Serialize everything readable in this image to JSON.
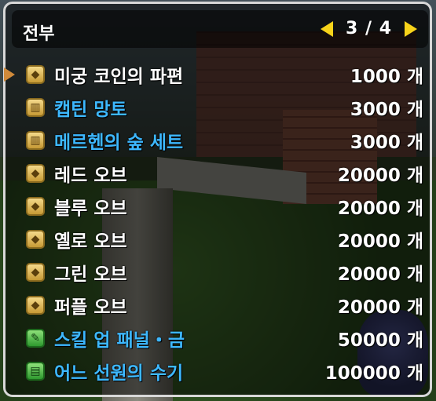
{
  "header": {
    "title": "전부",
    "page_indicator": "3 / 4"
  },
  "colors": {
    "accent_yellow": "#f7d31a",
    "name_blue": "#3db8ff",
    "name_white": "#ffffff",
    "selection_arrow": "#d08a3a"
  },
  "items": [
    {
      "name": "미궁 코인의 파편",
      "count": "1000 개",
      "icon": "coin-shard-icon",
      "name_color": "white",
      "selected": true
    },
    {
      "name": "캡틴 망토",
      "count": "3000 개",
      "icon": "gift-box-icon",
      "name_color": "blue",
      "selected": false
    },
    {
      "name": "메르헨의 숲 세트",
      "count": "3000 개",
      "icon": "gift-box-icon",
      "name_color": "blue",
      "selected": false
    },
    {
      "name": "레드 오브",
      "count": "20000 개",
      "icon": "coin-shard-icon",
      "name_color": "white",
      "selected": false
    },
    {
      "name": "블루 오브",
      "count": "20000 개",
      "icon": "coin-shard-icon",
      "name_color": "white",
      "selected": false
    },
    {
      "name": "옐로 오브",
      "count": "20000 개",
      "icon": "coin-shard-icon",
      "name_color": "white",
      "selected": false
    },
    {
      "name": "그린 오브",
      "count": "20000 개",
      "icon": "coin-shard-icon",
      "name_color": "white",
      "selected": false
    },
    {
      "name": "퍼플 오브",
      "count": "20000 개",
      "icon": "coin-shard-icon",
      "name_color": "white",
      "selected": false
    },
    {
      "name": "스킬 업 패널・금",
      "count": "50000 개",
      "icon": "leaf-panel-icon",
      "name_color": "blue",
      "selected": false
    },
    {
      "name": "어느 선원의 수기",
      "count": "100000 개",
      "icon": "green-book-icon",
      "name_color": "blue",
      "selected": false
    }
  ]
}
